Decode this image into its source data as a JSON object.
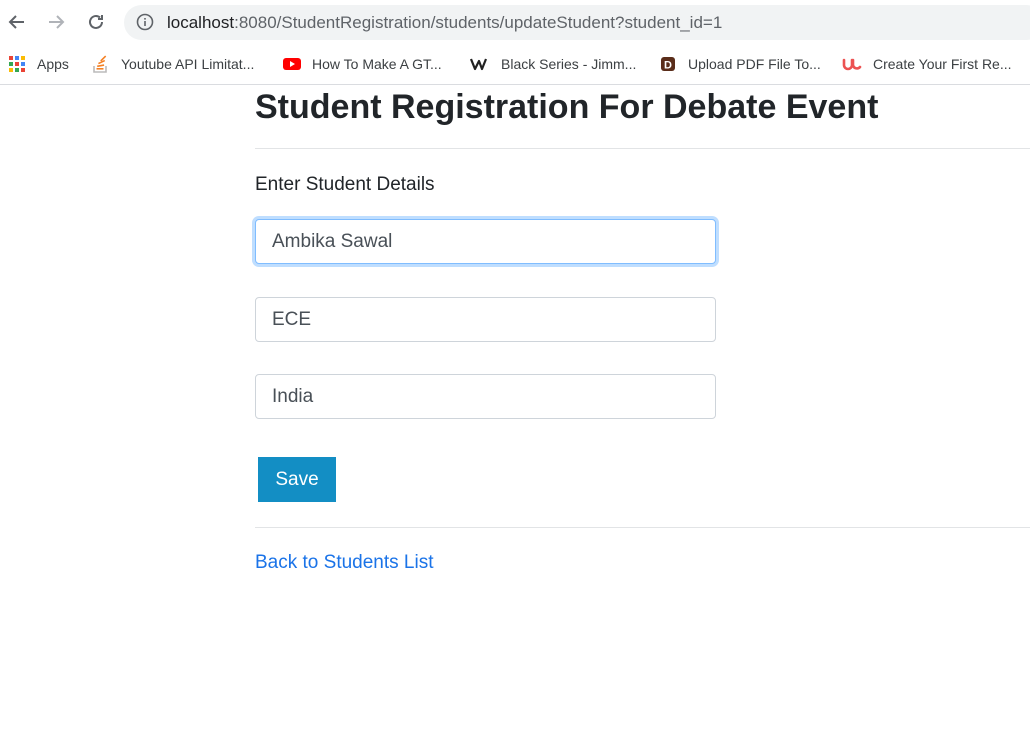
{
  "browser": {
    "url_host": "localhost",
    "url_rest": ":8080/StudentRegistration/students/updateStudent?student_id=1",
    "bookmarks": [
      {
        "label": "Apps",
        "icon": "apps-grid-icon"
      },
      {
        "label": "Youtube API Limitat...",
        "icon": "stackoverflow-icon"
      },
      {
        "label": "How To Make A GT...",
        "icon": "youtube-icon"
      },
      {
        "label": "Black Series - Jimm...",
        "icon": "weebly-icon"
      },
      {
        "label": "Upload PDF File To...",
        "icon": "d-favicon-icon"
      },
      {
        "label": "Create Your First Re...",
        "icon": "udemy-icon"
      }
    ]
  },
  "page": {
    "title": "Student Registration For Debate Event",
    "subtitle": "Enter Student Details",
    "form": {
      "name_value": "Ambika Sawal",
      "department_value": "ECE",
      "country_value": "India",
      "save_label": "Save"
    },
    "back_link": "Back to Students List"
  },
  "colors": {
    "save_button": "#138ec4",
    "link": "#1a73e8",
    "focus_border": "#80bdff"
  }
}
